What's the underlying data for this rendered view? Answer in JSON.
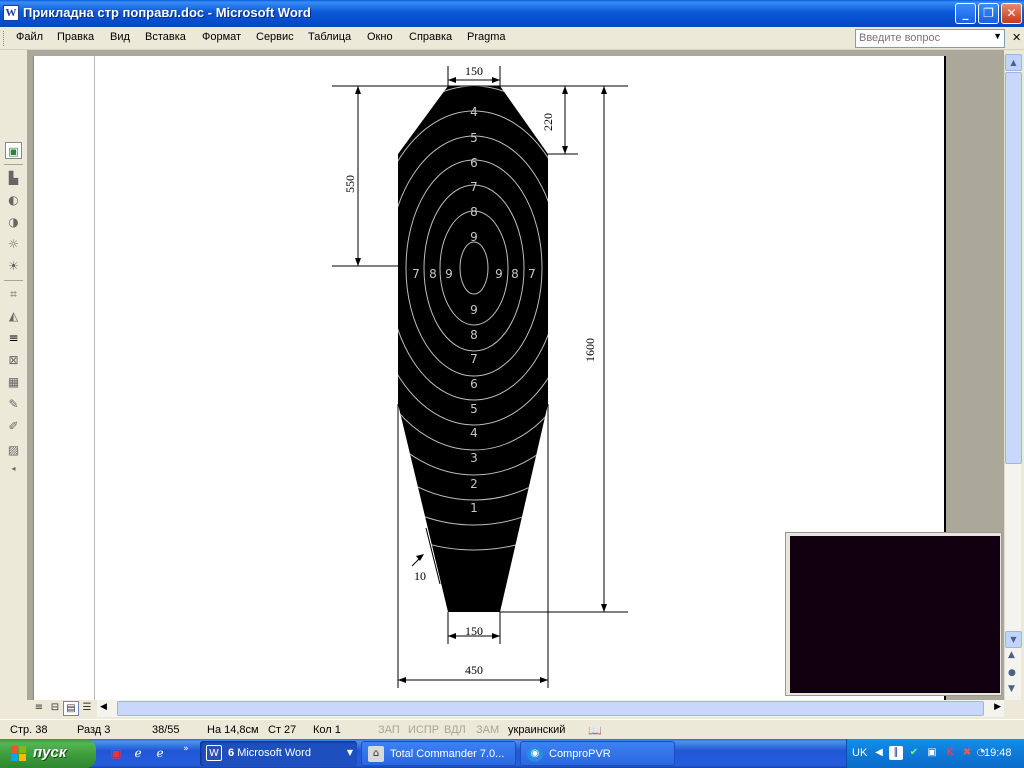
{
  "window": {
    "title": "Прикладна стр поправл.doc - Microsoft Word",
    "app_icon": "word-icon"
  },
  "menu": {
    "items": [
      "Файл",
      "Правка",
      "Вид",
      "Вставка",
      "Формат",
      "Сервис",
      "Таблица",
      "Окно",
      "Справка",
      "Pragma"
    ],
    "help_placeholder": "Введите вопрос"
  },
  "drawing": {
    "rings_upper": [
      "4",
      "5",
      "6",
      "7",
      "8",
      "9"
    ],
    "rings_lower": [
      "9",
      "8",
      "7",
      "6",
      "5",
      "4",
      "3",
      "2",
      "1"
    ],
    "side_left": [
      "7",
      "8",
      "9"
    ],
    "side_right": [
      "9",
      "8",
      "7"
    ],
    "dims": {
      "top_width": "150",
      "shoulder_height": "220",
      "center_height": "550",
      "total_height": "1600",
      "bottom_width": "150",
      "base_width": "450",
      "border_width": "10"
    }
  },
  "status": {
    "page": "Стр. 38",
    "section": "Разд 3",
    "pages": "38/55",
    "at": "На 14,8см",
    "line": "Ст 27",
    "col": "Кол 1",
    "rec": "ЗАП",
    "trk": "ИСПР",
    "ext": "ВДЛ",
    "ovr": "ЗАМ",
    "language": "украинский"
  },
  "taskbar": {
    "start_label": "пуск",
    "buttons": [
      {
        "label": "Microsoft Word",
        "count": "6",
        "icon": "word-icon",
        "active": true
      },
      {
        "label": "Total Commander 7.0...",
        "icon": "total-commander-icon",
        "active": false
      },
      {
        "label": "ComproPVR",
        "icon": "compropvr-icon",
        "active": false
      }
    ],
    "lang": "UK",
    "clock": "19:48"
  },
  "colors": {
    "titlebar": "#0a58d8",
    "taskbar": "#245edb",
    "start": "#3b9a3b",
    "target": "#000000",
    "video": "#100010"
  }
}
